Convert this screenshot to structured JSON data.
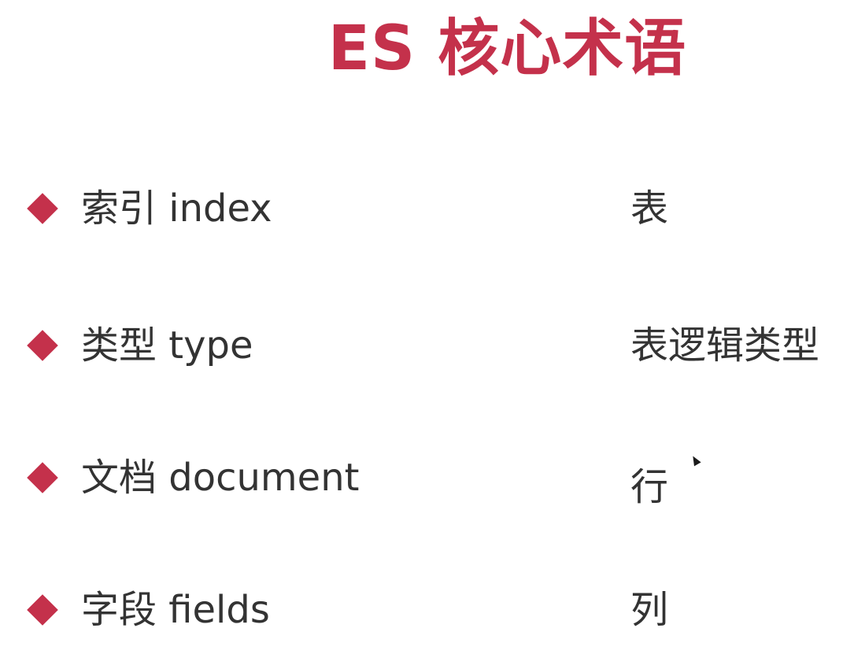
{
  "title": "ES 核心术语",
  "terms": [
    {
      "term": "索引 index",
      "meaning": "表"
    },
    {
      "term": "类型 type",
      "meaning": "表逻辑类型"
    },
    {
      "term": "文档 document",
      "meaning": "行"
    },
    {
      "term": "字段 fields",
      "meaning": "列"
    }
  ],
  "colors": {
    "accent": "#c4314b",
    "text": "#333333",
    "background": "#ffffff"
  },
  "icons": {
    "bullet": "diamond-bullet-icon",
    "cursor": "mouse-pointer-icon"
  }
}
